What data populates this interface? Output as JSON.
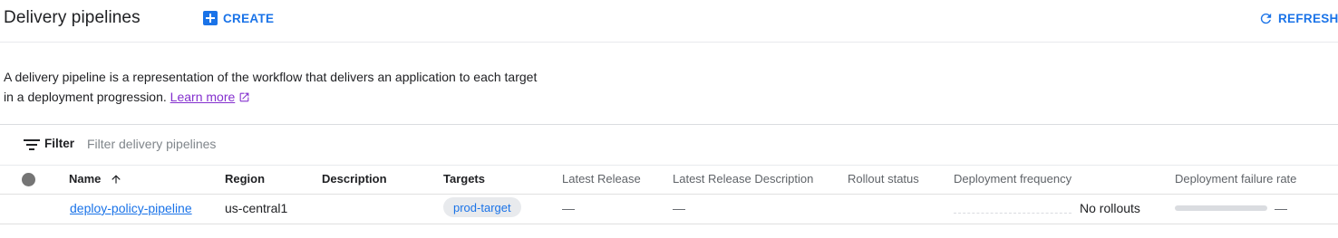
{
  "header": {
    "title": "Delivery pipelines",
    "create_label": "CREATE",
    "refresh_label": "REFRESH"
  },
  "description": {
    "text": "A delivery pipeline is a representation of the workflow that delivers an application to each target in a deployment progression.",
    "learn_more": "Learn more"
  },
  "filter": {
    "label": "Filter",
    "placeholder": "Filter delivery pipelines",
    "value": ""
  },
  "table": {
    "columns": {
      "name": "Name",
      "region": "Region",
      "description": "Description",
      "targets": "Targets",
      "latest_release": "Latest Release",
      "latest_release_description": "Latest Release Description",
      "rollout_status": "Rollout status",
      "deployment_frequency": "Deployment frequency",
      "deployment_failure_rate": "Deployment failure rate"
    },
    "sort": {
      "column": "Name",
      "direction": "ascending"
    },
    "rows": [
      {
        "name": "deploy-policy-pipeline",
        "region": "us-central1",
        "description": "",
        "targets": [
          "prod-target"
        ],
        "latest_release": "—",
        "latest_release_description": "—",
        "rollout_status": "",
        "deployment_frequency": "No rollouts",
        "deployment_failure_rate": "—",
        "deployment_failure_rate_fraction": 0
      }
    ]
  },
  "icons": {
    "create": "add-box-icon",
    "refresh": "refresh-icon",
    "external_link": "open-in-new-icon",
    "filter": "filter-list-icon",
    "sort": "arrow-upward-icon",
    "status": "status-dot-icon"
  },
  "colors": {
    "accent": "#1a73e8",
    "link_visited": "#8430ce",
    "text_primary": "#202124",
    "text_secondary": "#5f6368",
    "chip_bg": "#e8eaed",
    "status_dot": "#757575"
  }
}
